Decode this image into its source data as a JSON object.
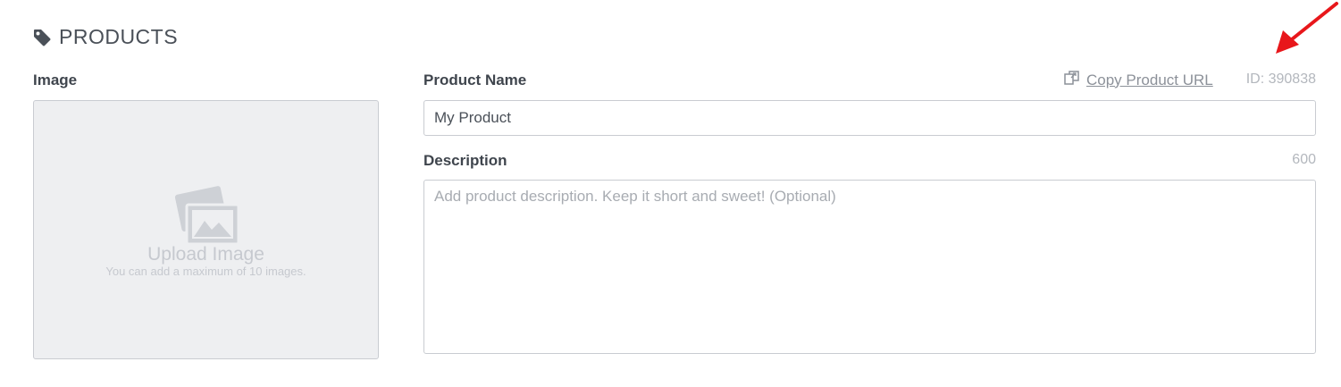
{
  "header": {
    "title": "PRODUCTS",
    "icon": "tag-icon"
  },
  "image_section": {
    "label": "Image",
    "upload_title": "Upload Image",
    "upload_note": "You can add a maximum of 10 images.",
    "icon": "photo-placeholder-icon"
  },
  "product_name": {
    "label": "Product Name",
    "value": "My Product",
    "copy_link_label": "Copy Product URL",
    "copy_icon": "copy-icon",
    "product_id": "ID: 390838"
  },
  "description": {
    "label": "Description",
    "char_count": "600",
    "value": "",
    "placeholder": "Add product description. Keep it short and sweet! (Optional)"
  },
  "annotation": {
    "icon": "red-arrow-icon",
    "color": "#e8171b"
  },
  "colors": {
    "text": "#4a5058",
    "muted": "#b3b7bd",
    "border": "#c9ccd1",
    "upload_bg": "#eeeff1"
  }
}
